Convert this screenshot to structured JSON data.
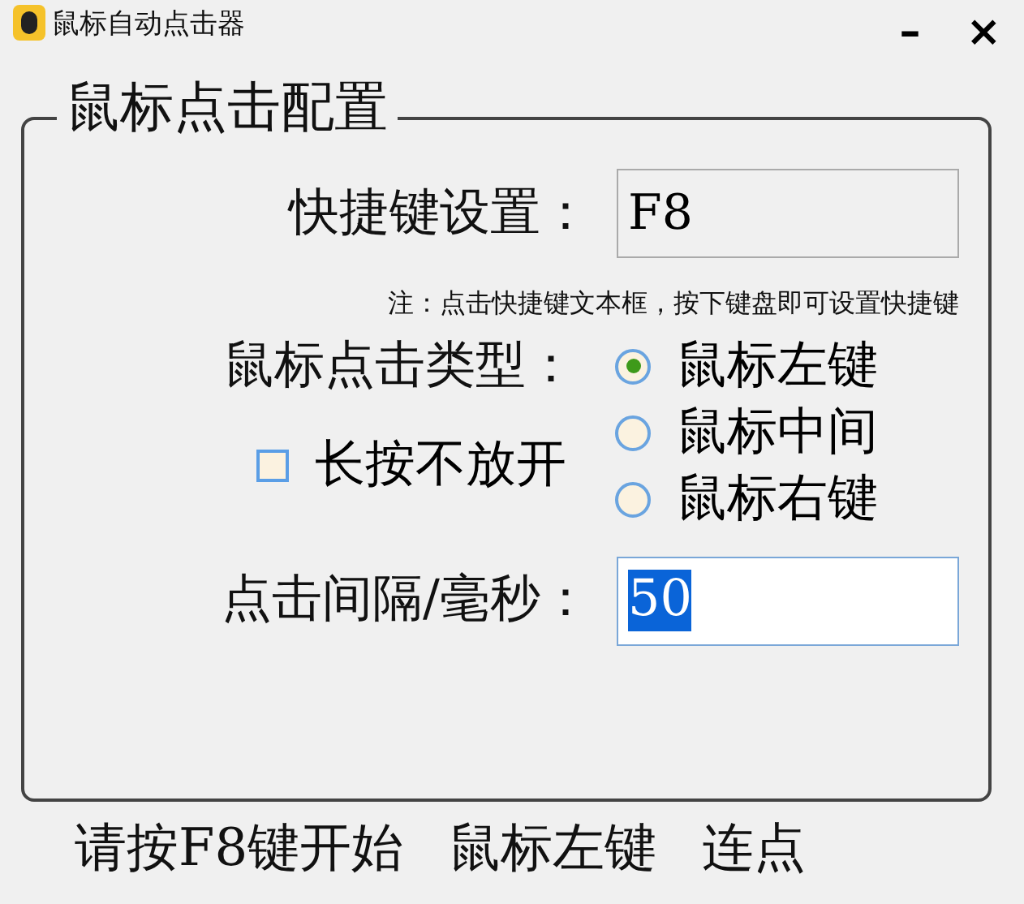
{
  "window": {
    "title": "鼠标自动点击器",
    "controls": [
      "–",
      "×"
    ]
  },
  "group": {
    "title": "鼠标点击配置",
    "hotkey": {
      "label": "快捷键设置：",
      "value": "F8"
    },
    "note": "注：点击快捷键文本框，按下键盘即可设置快捷键",
    "click_type": {
      "label": "鼠标点击类型：",
      "options": [
        {
          "label": "鼠标左键",
          "selected": true
        },
        {
          "label": "鼠标中间",
          "selected": false
        },
        {
          "label": "鼠标右键",
          "selected": false
        }
      ]
    },
    "hold": {
      "label": "长按不放开",
      "checked": false
    },
    "interval": {
      "label": "点击间隔/毫秒：",
      "value": "50",
      "selected": true
    }
  },
  "status_bar": [
    "请按F8键开始",
    "鼠标左键",
    "连点"
  ]
}
